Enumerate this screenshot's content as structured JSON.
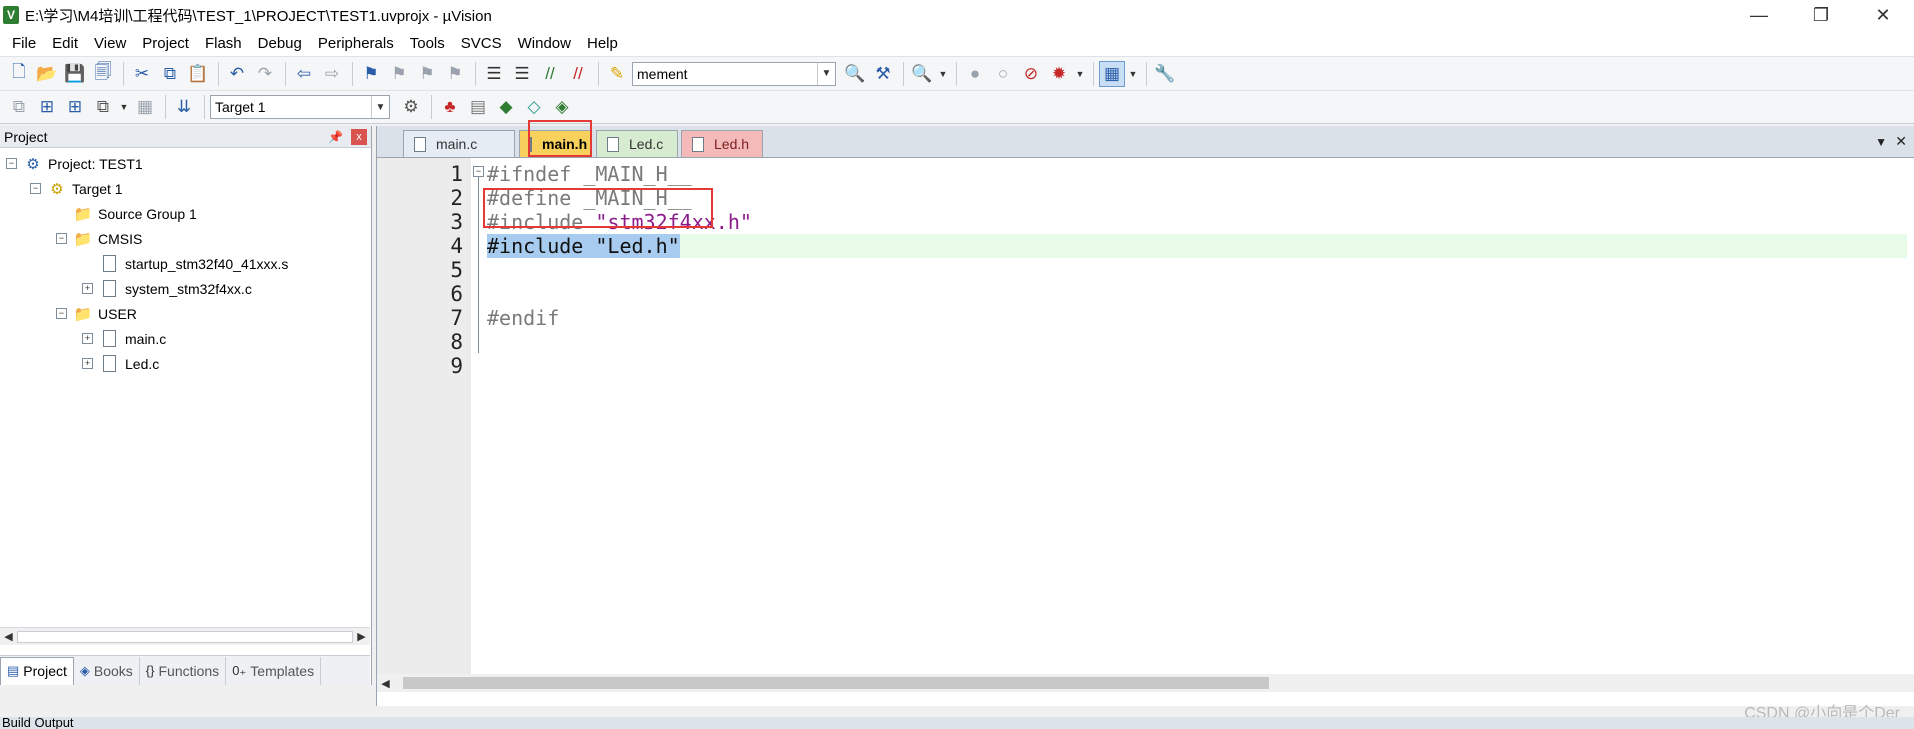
{
  "window": {
    "title": "E:\\学习\\M4培训\\工程代码\\TEST_1\\PROJECT\\TEST1.uvprojx - µVision",
    "app_icon": "V",
    "minimize": "—",
    "restore": "❐",
    "close": "✕"
  },
  "menu": [
    "File",
    "Edit",
    "View",
    "Project",
    "Flash",
    "Debug",
    "Peripherals",
    "Tools",
    "SVCS",
    "Window",
    "Help"
  ],
  "toolbar1": {
    "find_combo_value": "mement"
  },
  "toolbar2": {
    "target_combo_value": "Target 1"
  },
  "project_panel": {
    "title": "Project",
    "pin": "📌",
    "close": "x",
    "tree": [
      {
        "label": "Project: TEST1",
        "expander": "−",
        "icon": "project-icon"
      },
      {
        "label": "Target 1",
        "expander": "−",
        "icon": "target-icon"
      },
      {
        "label": "Source Group 1",
        "expander": "",
        "icon": "folder-icon"
      },
      {
        "label": "CMSIS",
        "expander": "−",
        "icon": "folder-icon"
      },
      {
        "label": "startup_stm32f40_41xxx.s",
        "expander": "",
        "icon": "file-icon"
      },
      {
        "label": "system_stm32f4xx.c",
        "expander": "+",
        "icon": "file-icon"
      },
      {
        "label": "USER",
        "expander": "−",
        "icon": "folder-icon"
      },
      {
        "label": "main.c",
        "expander": "+",
        "icon": "file-icon"
      },
      {
        "label": "Led.c",
        "expander": "+",
        "icon": "file-icon"
      }
    ],
    "tabs": [
      "Project",
      "Books",
      "Functions",
      "Templates"
    ],
    "tab_icons": [
      "▤",
      "◈",
      "{}",
      "0₊"
    ]
  },
  "editor": {
    "tabs": [
      "main.c",
      "main.h",
      "Led.c",
      "Led.h"
    ],
    "active_tab": "main.h",
    "line_numbers": [
      "1",
      "2",
      "3",
      "4",
      "5",
      "6",
      "7",
      "8",
      "9"
    ],
    "fold_marker": "−",
    "code": {
      "line1": "#ifndef _MAIN_H__",
      "line2": "#define _MAIN_H__",
      "line3_directive": "#include ",
      "line3_string": "\"stm32f4xx.h\"",
      "line4": "#include \"Led.h\"",
      "line7": "#endif"
    },
    "dropdown_arrow": "▼",
    "close": "✕",
    "watermark": "CSDN @小向是个Der"
  },
  "build_output": {
    "title": "Build Output"
  },
  "colors": {
    "highlight_box": "#e53935",
    "active_tab": "#f7d15b",
    "selection": "#a8ccf0",
    "current_line": "#e8fbe8"
  }
}
